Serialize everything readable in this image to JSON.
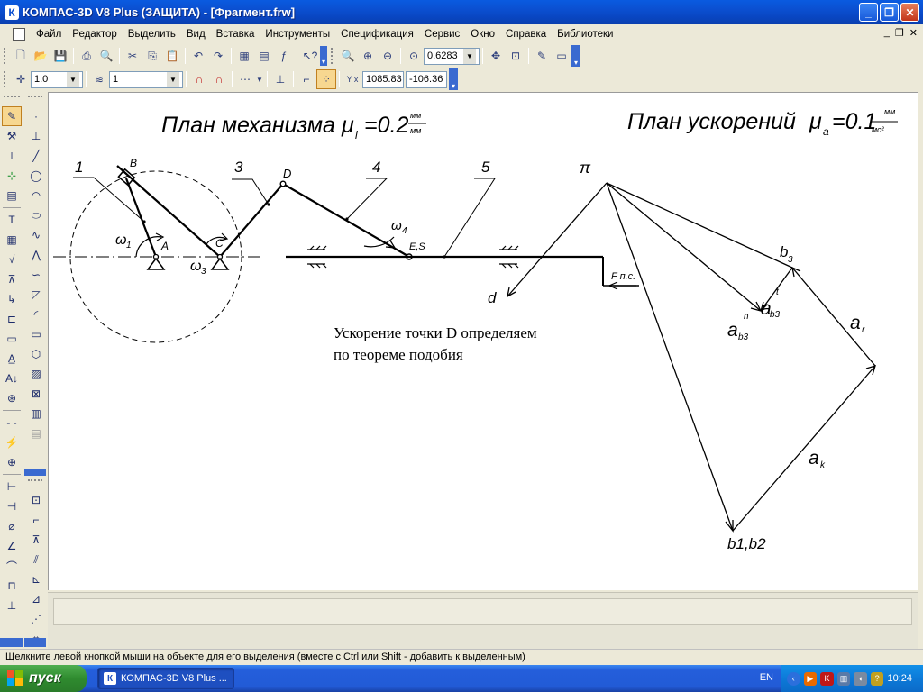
{
  "window": {
    "title": "КОМПАС-3D V8 Plus (ЗАЩИТА) - [Фрагмент.frw]",
    "app_icon": "kompas-logo-icon",
    "controls": [
      "minimize",
      "restore",
      "close"
    ]
  },
  "menubar": {
    "items": [
      "Файл",
      "Редактор",
      "Выделить",
      "Вид",
      "Вставка",
      "Инструменты",
      "Спецификация",
      "Сервис",
      "Окно",
      "Справка",
      "Библиотеки"
    ],
    "mdi_controls": [
      "minimize",
      "restore",
      "close"
    ]
  },
  "toolbar_standard": {
    "zoom_value": "0.6283",
    "icons": [
      "new-document-icon",
      "open-icon",
      "save-icon",
      "print-icon",
      "print-preview-icon",
      "cut-icon",
      "copy-icon",
      "paste-icon",
      "undo-icon",
      "redo-icon",
      "variables-icon",
      "library-icon",
      "function-icon",
      "help-pointer-icon",
      "zoom-window-icon",
      "zoom-in-icon",
      "zoom-out-icon",
      "zoom-scale-icon",
      "pan-icon",
      "zoom-all-icon",
      "rebuild-icon",
      "display-icon"
    ]
  },
  "toolbar_current_state": {
    "step_value": "1.0",
    "layer_value": "1",
    "coord_x": "1085.83",
    "coord_y": "-106.36",
    "coord_label": "Y x"
  },
  "drawing": {
    "title_mechanism": "План механизма",
    "mu_l_label": "μ",
    "mu_l_sub": "l",
    "mu_l_value": "=0.2",
    "mu_l_units_num": "мм",
    "mu_l_units_den": "мм",
    "title_accel": "План ускорений",
    "mu_a_label": "μ",
    "mu_a_sub": "a",
    "mu_a_value": "=0.1",
    "mu_a_units_num": "мм",
    "mu_a_units_den": "мс²",
    "link_labels": [
      "1",
      "3",
      "4",
      "5"
    ],
    "point_labels": [
      "B",
      "A",
      "C",
      "D",
      "E,S"
    ],
    "omega_1": "ω",
    "omega_1_sub": "1",
    "omega_3": "ω",
    "omega_3_sub": "3",
    "omega_4": "ω",
    "omega_4_sub": "4",
    "force_label": "F п.с.",
    "pi_label": "π",
    "d_label": "d",
    "b3_label": "b",
    "b3_sub": "3",
    "a_b3_t_label": "a",
    "a_b3_t_sub": "b3",
    "a_b3_t_sup": "t",
    "a_b3_n_label": "a",
    "a_b3_n_sub": "b3",
    "a_b3_n_sup": "n",
    "a_r_label": "a",
    "a_r_sub": "r",
    "a_k_label": "a",
    "a_k_sub": "k",
    "b1b2_label": "b1,b2",
    "note_line1": "Ускорение точки D определяем",
    "note_line2": "по теореме подобия"
  },
  "statusbar": {
    "text": "Щелкните левой кнопкой мыши на объекте для его выделения (вместе с Ctrl или Shift - добавить к выделенным)"
  },
  "taskbar": {
    "start_label": "пуск",
    "task_label": "КОМПАС-3D V8 Plus ...",
    "lang": "EN",
    "time": "10:24"
  },
  "colors": {
    "titlebar": "#0b4fd0",
    "taskbar": "#245edb",
    "start": "#2f8b2f",
    "chrome": "#ece9d8",
    "canvas": "#ffffff"
  }
}
